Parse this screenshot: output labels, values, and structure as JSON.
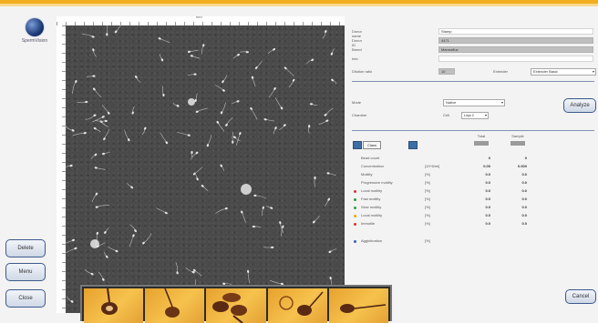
{
  "app": {
    "logo_text": "SpermVision"
  },
  "sidebar": {
    "delete": "Delete",
    "menu": "Menu",
    "close": "Close"
  },
  "viewer": {
    "ruler_label": "mm"
  },
  "form": {
    "fields": [
      {
        "label": "Donor name",
        "value": "Stamp"
      },
      {
        "label": "Donor ID",
        "value": "4471"
      },
      {
        "label": "Breed",
        "value": "Marmafluz"
      },
      {
        "label": "Info",
        "value": ""
      }
    ],
    "dilution_label": "Dilution ratio",
    "dilution_value": "10",
    "extender_label": "Extender",
    "extender_value": "Extender Basic"
  },
  "settings": {
    "mode_label": "Mode",
    "mode_value": "Native",
    "chamber_label": "Chamber",
    "chamber_prefix": "Cell",
    "chamber_value": "Leja 2"
  },
  "buttons": {
    "analyze": "Analyze",
    "cancel": "Cancel",
    "class": "Class"
  },
  "results": {
    "col_total": "Total",
    "col_sample": "Sample",
    "rows": [
      {
        "label": "Bead count",
        "unit": "",
        "v1": "0",
        "v2": "0",
        "dot": ""
      },
      {
        "label": "Concentration",
        "unit": "[10^6/ml]",
        "v1": "0.00",
        "v2": "0.000",
        "dot": ""
      },
      {
        "label": "Motility",
        "unit": "[%]",
        "v1": "0.0",
        "v2": "0.0",
        "dot": ""
      },
      {
        "label": "Progressive motility",
        "unit": "[%]",
        "v1": "0.0",
        "v2": "0.0",
        "dot": ""
      },
      {
        "label": "Local motility",
        "unit": "[%]",
        "v1": "0.0",
        "v2": "0.0",
        "dot": "#d03a2a"
      },
      {
        "label": "Fast motility",
        "unit": "[%]",
        "v1": "0.0",
        "v2": "0.0",
        "dot": "#2a9a3a"
      },
      {
        "label": "Slow motility",
        "unit": "[%]",
        "v1": "0.0",
        "v2": "0.0",
        "dot": "#2f9e44"
      },
      {
        "label": "Local motility",
        "unit": "[%]",
        "v1": "0.0",
        "v2": "0.0",
        "dot": "#e6a817"
      },
      {
        "label": "Immotile",
        "unit": "[%]",
        "v1": "0.0",
        "v2": "0.0",
        "dot": "#d03a2a"
      }
    ],
    "agglutination": {
      "label": "Agglutination",
      "unit": "[%]",
      "dot": "#3566b0"
    }
  }
}
